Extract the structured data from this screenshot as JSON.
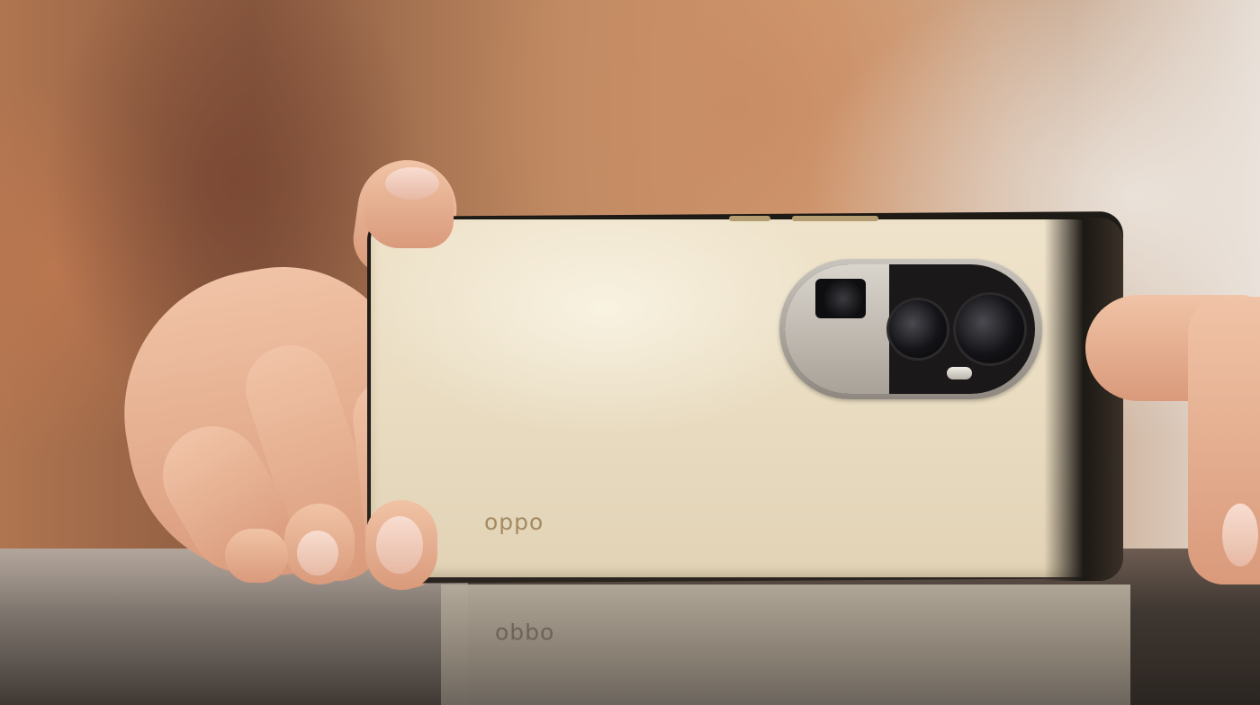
{
  "photo": {
    "subject": "smartphone-back",
    "brand_logo_text": "oppo",
    "reflection_logo_text": "oppo",
    "camera_plate_text": "",
    "colors": {
      "phone_back": "#ebdec4",
      "phone_frame": "#1e1a16",
      "camera_ring": "#b9b3ab",
      "logo": "#a48a63",
      "skin": "#e8b294"
    }
  }
}
